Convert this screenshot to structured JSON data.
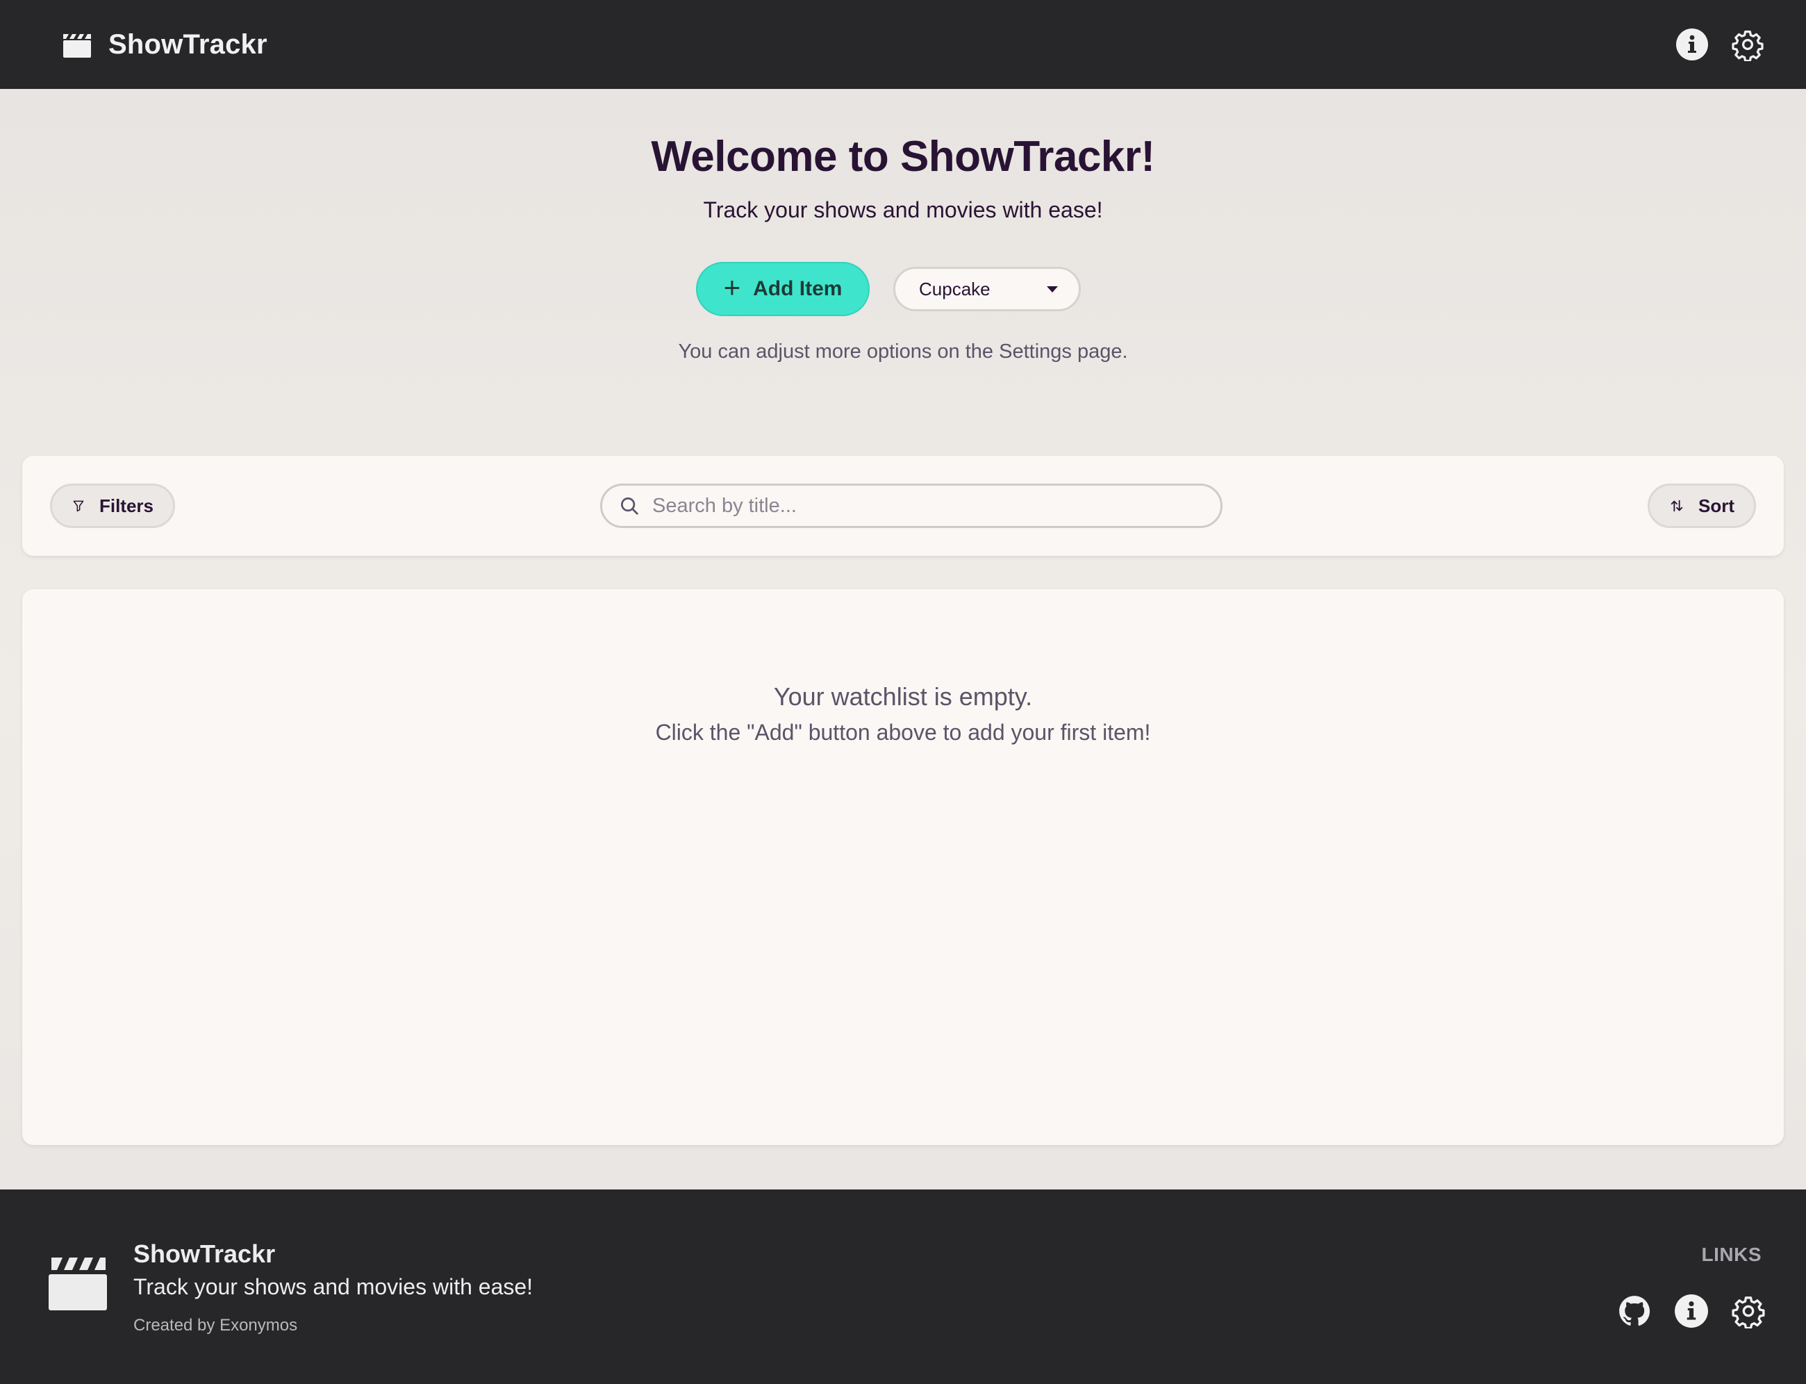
{
  "header": {
    "title": "ShowTrackr",
    "logo_icon": "clapperboard-icon",
    "info_icon": "info-icon",
    "settings_icon": "gear-icon"
  },
  "hero": {
    "title": "Welcome to ShowTrackr!",
    "subtitle": "Track your shows and movies with ease!",
    "add_button_label": "Add Item",
    "theme_selected": "Cupcake",
    "hint": "You can adjust more options on the Settings page."
  },
  "toolbar": {
    "filters_label": "Filters",
    "search_placeholder": "Search by title...",
    "search_value": "",
    "sort_label": "Sort"
  },
  "watchlist": {
    "empty_title": "Your watchlist is empty.",
    "empty_message": "Click the \"Add\" button above to add your first item!"
  },
  "footer": {
    "name": "ShowTrackr",
    "tagline": "Track your shows and movies with ease!",
    "credit": "Created by Exonymos",
    "links_title": "LINKS",
    "link_icons": [
      "github-icon",
      "info-icon",
      "gear-icon"
    ]
  },
  "colors": {
    "navbar": "#27272a",
    "primary_accent": "#3ee5cc",
    "text": "#291334",
    "muted_text": "#5b5368",
    "card": "#faf7f4"
  }
}
